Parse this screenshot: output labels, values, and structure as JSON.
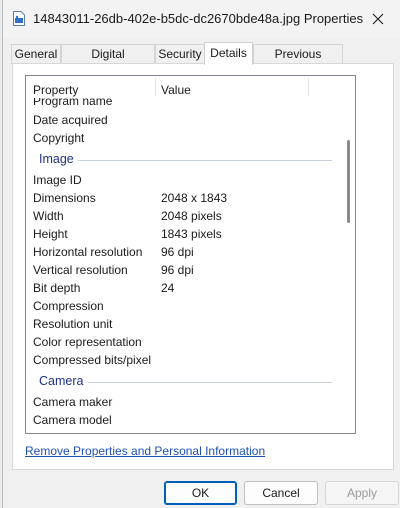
{
  "window": {
    "title": "14843011-26db-402e-b5dc-dc2670bde48a.jpg Properties"
  },
  "tabs": [
    {
      "label": "General",
      "active": false
    },
    {
      "label": "Digital Signatures",
      "active": false
    },
    {
      "label": "Security",
      "active": false
    },
    {
      "label": "Details",
      "active": true
    },
    {
      "label": "Previous Versions",
      "active": false
    }
  ],
  "details": {
    "columns": {
      "property": "Property",
      "value": "Value"
    },
    "top_rows": [
      {
        "name": "Program name",
        "value": ""
      },
      {
        "name": "Date acquired",
        "value": ""
      },
      {
        "name": "Copyright",
        "value": ""
      }
    ],
    "image_group": {
      "label": "Image",
      "rows": [
        {
          "name": "Image ID",
          "value": ""
        },
        {
          "name": "Dimensions",
          "value": "2048 x 1843"
        },
        {
          "name": "Width",
          "value": "2048 pixels"
        },
        {
          "name": "Height",
          "value": "1843 pixels"
        },
        {
          "name": "Horizontal resolution",
          "value": "96 dpi"
        },
        {
          "name": "Vertical resolution",
          "value": "96 dpi"
        },
        {
          "name": "Bit depth",
          "value": "24"
        },
        {
          "name": "Compression",
          "value": ""
        },
        {
          "name": "Resolution unit",
          "value": ""
        },
        {
          "name": "Color representation",
          "value": ""
        },
        {
          "name": "Compressed bits/pixel",
          "value": ""
        }
      ]
    },
    "camera_group": {
      "label": "Camera",
      "rows": [
        {
          "name": "Camera maker",
          "value": ""
        },
        {
          "name": "Camera model",
          "value": ""
        }
      ]
    }
  },
  "remove_link": "Remove Properties and Personal Information",
  "buttons": {
    "ok": "OK",
    "cancel": "Cancel",
    "apply": "Apply",
    "apply_enabled": false
  },
  "icons": {
    "title": "image-file-icon",
    "close": "close-icon"
  }
}
